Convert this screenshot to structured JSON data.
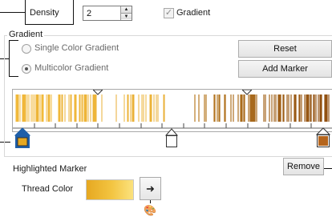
{
  "density": {
    "label": "Density",
    "value": "2",
    "up_arrow": "▲",
    "down_arrow": "▼"
  },
  "gradient_checkbox": {
    "label": "Gradient",
    "checked": true,
    "check_glyph": "✓"
  },
  "gradient_group": {
    "title": "Gradient",
    "options": [
      {
        "label": "Single Color Gradient",
        "selected": false
      },
      {
        "label": "Multicolor Gradient",
        "selected": true
      }
    ],
    "reset_label": "Reset",
    "add_marker_label": "Add Marker"
  },
  "gradient_strip": {
    "start_color": "#f5bd3c",
    "end_color": "#8b4a10",
    "markers": [
      {
        "name": "start-marker",
        "position": 0.0,
        "color": "#e6a821",
        "selected": true,
        "icon": "marker-selected-icon"
      },
      {
        "name": "middle-marker",
        "position": 0.5,
        "color": "#ffffff",
        "selected": false,
        "icon": "marker-icon"
      },
      {
        "name": "end-marker",
        "position": 1.0,
        "color": "#b5651d",
        "selected": false,
        "icon": "marker-icon"
      }
    ]
  },
  "highlighted_marker": {
    "title": "Highlighted Marker",
    "thread_color_label": "Thread Color",
    "thread_color": "#f3c542",
    "picker_icon": "color-picker-icon",
    "picker_glyph": "➜🎨",
    "remove_label": "Remove"
  }
}
